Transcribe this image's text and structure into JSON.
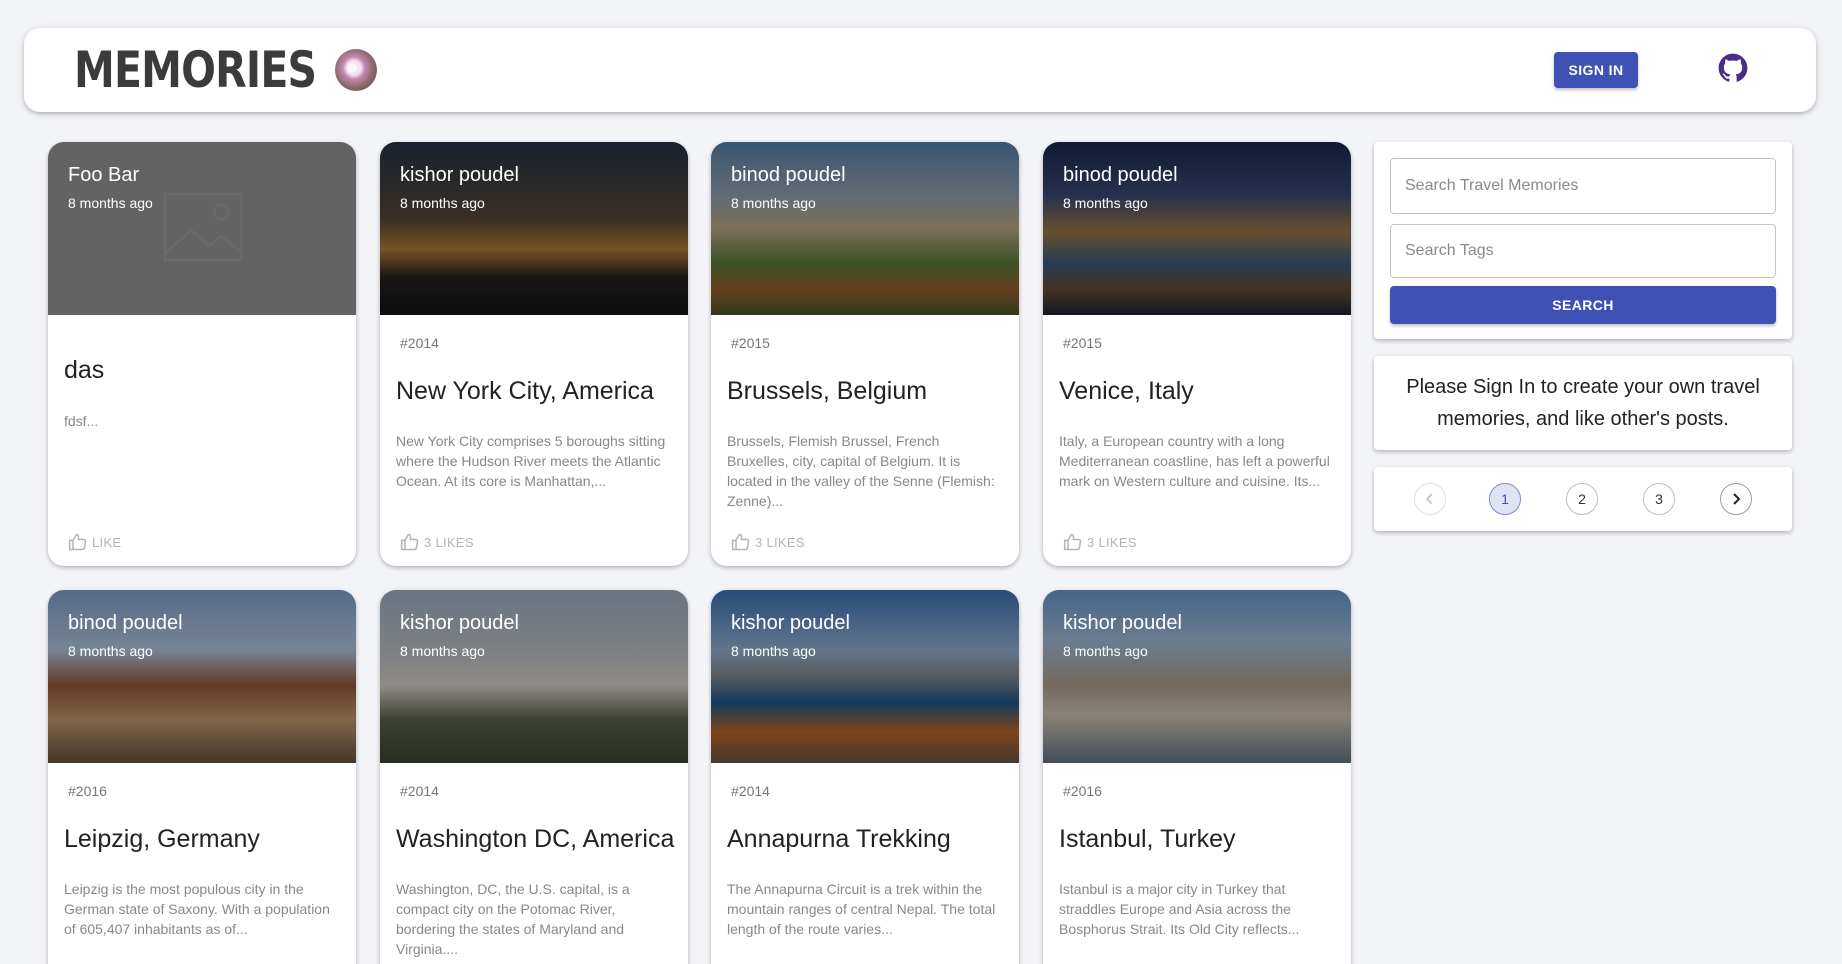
{
  "header": {
    "brand_title": "MEMORIES",
    "signin_label": "SIGN IN",
    "accent_color": "#3f51b5"
  },
  "icons": {
    "brand_logo": "flower-logo-icon",
    "github": "github-icon",
    "like": "thumb-up-icon",
    "placeholder": "image-placeholder-icon",
    "prev": "chevron-left-icon",
    "next": "chevron-right-icon"
  },
  "cards": [
    {
      "author": "Foo Bar",
      "time": "8 months ago",
      "tags": "",
      "title": "das",
      "message": "fdsf...",
      "like_label": "LIKE"
    },
    {
      "author": "kishor poudel",
      "time": "8 months ago",
      "tags": "#2014",
      "title": "New York City, America",
      "message": "New York City comprises 5 boroughs sitting where the Hudson River meets the Atlantic Ocean. At its core is Manhattan,...",
      "like_label": "3 LIKES"
    },
    {
      "author": "binod poudel",
      "time": "8 months ago",
      "tags": "#2015",
      "title": "Brussels, Belgium",
      "message": "Brussels, Flemish Brussel, French Bruxelles, city, capital of Belgium. It is located in the valley of the Senne (Flemish: Zenne)...",
      "like_label": "3 LIKES"
    },
    {
      "author": "binod poudel",
      "time": "8 months ago",
      "tags": "#2015",
      "title": "Venice, Italy",
      "message": "Italy, a European country with a long Mediterranean coastline, has left a powerful mark on Western culture and cuisine. Its...",
      "like_label": "3 LIKES"
    },
    {
      "author": "binod poudel",
      "time": "8 months ago",
      "tags": "#2016",
      "title": "Leipzig, Germany",
      "message": "Leipzig is the most populous city in the German state of Saxony. With a population of 605,407 inhabitants as of...",
      "like_label": ""
    },
    {
      "author": "kishor poudel",
      "time": "8 months ago",
      "tags": "#2014",
      "title": "Washington DC, America",
      "message": "Washington, DC, the U.S. capital, is a compact city on the Potomac River, bordering the states of Maryland and Virginia....",
      "like_label": ""
    },
    {
      "author": "kishor poudel",
      "time": "8 months ago",
      "tags": "#2014",
      "title": "Annapurna Trekking",
      "message": "The Annapurna Circuit is a trek within the mountain ranges of central Nepal. The total length of the route varies...",
      "like_label": ""
    },
    {
      "author": "kishor poudel",
      "time": "8 months ago",
      "tags": "#2016",
      "title": "Istanbul, Turkey",
      "message": "Istanbul is a major city in Turkey that straddles Europe and Asia across the Bosphorus Strait. Its Old City reflects...",
      "like_label": ""
    }
  ],
  "search": {
    "memories_placeholder": "Search Travel Memories",
    "tags_placeholder": "Search Tags",
    "button_label": "SEARCH"
  },
  "info": {
    "message": "Please Sign In to create your own travel memories, and like other's posts."
  },
  "pagination": {
    "pages": [
      "1",
      "2",
      "3"
    ],
    "current": "1"
  }
}
